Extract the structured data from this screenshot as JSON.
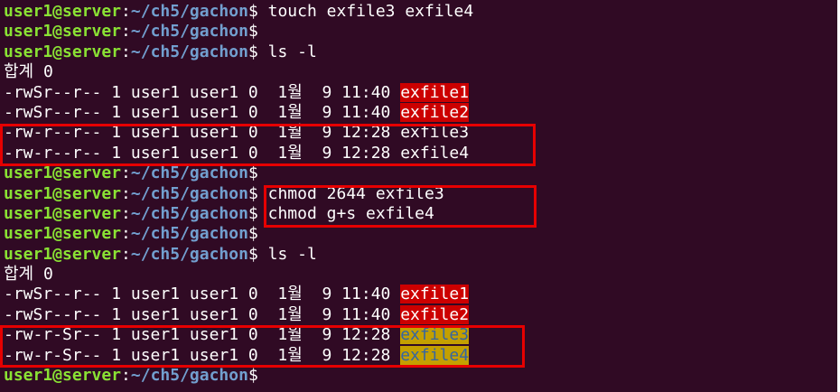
{
  "prompt": {
    "user_host": "user1@server",
    "colon": ":",
    "path": "~/ch5/gachon",
    "symbol": "$ "
  },
  "lines": [
    {
      "type": "prompt",
      "cmd": "touch exfile3 exfile4"
    },
    {
      "type": "prompt",
      "cmd": ""
    },
    {
      "type": "prompt",
      "cmd": "ls -l"
    },
    {
      "type": "text",
      "text": "합계 0"
    },
    {
      "type": "file",
      "pre": "-rwSr--r-- 1 user1 user1 0  1월  9 11:40 ",
      "name": "exfile1",
      "hl": "red"
    },
    {
      "type": "file",
      "pre": "-rwSr--r-- 1 user1 user1 0  1월  9 11:40 ",
      "name": "exfile2",
      "hl": "red"
    },
    {
      "type": "file",
      "pre": "-rw-r--r-- 1 user1 user1 0  1월  9 12:28 ",
      "name": "exfile3",
      "hl": ""
    },
    {
      "type": "file",
      "pre": "-rw-r--r-- 1 user1 user1 0  1월  9 12:28 ",
      "name": "exfile4",
      "hl": ""
    },
    {
      "type": "prompt",
      "cmd": ""
    },
    {
      "type": "prompt",
      "cmd": "chmod 2644 exfile3"
    },
    {
      "type": "prompt",
      "cmd": "chmod g+s exfile4"
    },
    {
      "type": "prompt",
      "cmd": ""
    },
    {
      "type": "prompt",
      "cmd": "ls -l"
    },
    {
      "type": "text",
      "text": "합계 0"
    },
    {
      "type": "file",
      "pre": "-rwSr--r-- 1 user1 user1 0  1월  9 11:40 ",
      "name": "exfile1",
      "hl": "red"
    },
    {
      "type": "file",
      "pre": "-rwSr--r-- 1 user1 user1 0  1월  9 11:40 ",
      "name": "exfile2",
      "hl": "red"
    },
    {
      "type": "file",
      "pre": "-rw-r-Sr-- 1 user1 user1 0  1월  9 12:28 ",
      "name": "exfile3",
      "hl": "yellow"
    },
    {
      "type": "file",
      "pre": "-rw-r-Sr-- 1 user1 user1 0  1월  9 12:28 ",
      "name": "exfile4",
      "hl": "yellow"
    },
    {
      "type": "prompt",
      "cmd": ""
    }
  ],
  "colors": {
    "background": "#300a24",
    "user_host": "#8ae234",
    "path": "#729fcf",
    "text": "#ffffff",
    "highlight_red": "#cc0000",
    "highlight_yellow": "#c4a000",
    "annotation_box": "#e60000"
  }
}
